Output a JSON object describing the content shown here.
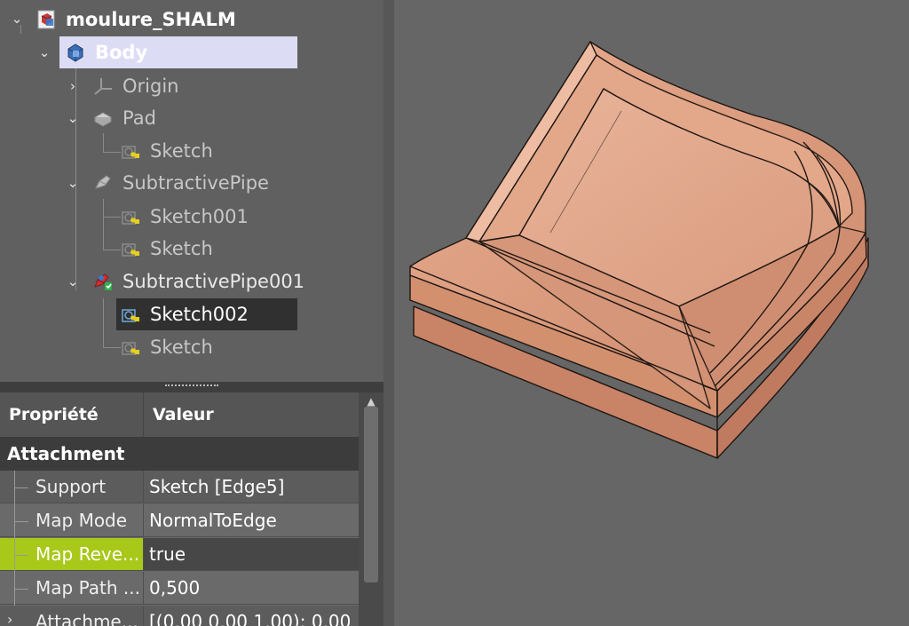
{
  "tree": {
    "items": [
      {
        "label": "moulure_SHALM",
        "icon": "document-icon"
      },
      {
        "label": "Body",
        "icon": "body-icon"
      },
      {
        "label": "Origin",
        "icon": "origin-icon"
      },
      {
        "label": "Pad",
        "icon": "pad-icon"
      },
      {
        "label": "Sketch",
        "icon": "sketch-icon"
      },
      {
        "label": "SubtractivePipe",
        "icon": "subtractive-pipe-icon"
      },
      {
        "label": "Sketch001",
        "icon": "sketch-icon"
      },
      {
        "label": "Sketch",
        "icon": "sketch-icon"
      },
      {
        "label": "SubtractivePipe001",
        "icon": "subtractive-pipe-active-icon"
      },
      {
        "label": "Sketch002",
        "icon": "sketch-icon"
      },
      {
        "label": "Sketch",
        "icon": "sketch-icon"
      }
    ]
  },
  "properties": {
    "col_property": "Propriété",
    "col_value": "Valeur",
    "group": "Attachment",
    "rows": [
      {
        "key": "Support",
        "value": "Sketch [Edge5]"
      },
      {
        "key": "Map Mode",
        "value": "NormalToEdge"
      },
      {
        "key": "Map Reve...",
        "value": "true"
      },
      {
        "key": "Map Path ...",
        "value": "0,500"
      },
      {
        "key": "Attachme...",
        "value": "[(0,00 0,00 1,00); 0,00"
      }
    ]
  },
  "colors": {
    "selection_highlight": "#dcdcf4",
    "selected_property": "#a8c81a",
    "model_fill": "#d9977a",
    "model_edge": "#1e1612"
  }
}
